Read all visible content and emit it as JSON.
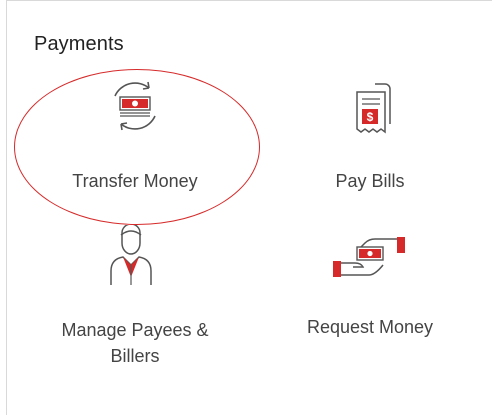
{
  "section": {
    "title": "Payments"
  },
  "tiles": [
    {
      "id": "transfer",
      "label": "Transfer Money",
      "icon": "transfer-money-icon"
    },
    {
      "id": "paybills",
      "label": "Pay Bills",
      "icon": "bill-receipt-icon"
    },
    {
      "id": "payees",
      "label_line1": "Manage Payees &",
      "label_line2": "Billers",
      "icon": "person-manager-icon"
    },
    {
      "id": "request",
      "label": "Request Money",
      "icon": "request-money-hand-icon"
    }
  ],
  "colors": {
    "accent_red": "#d62a2a",
    "text": "#444444",
    "icon_stroke": "#555555"
  }
}
